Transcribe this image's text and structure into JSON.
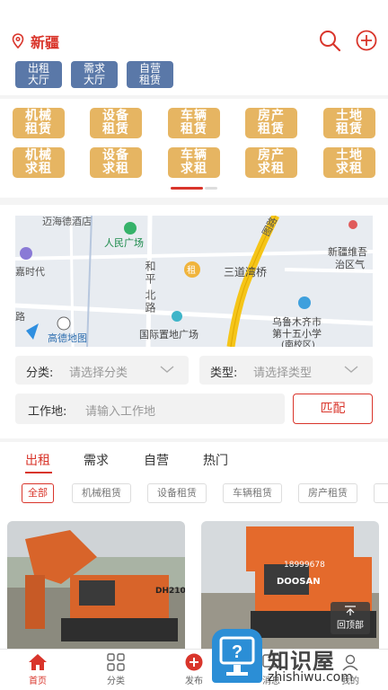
{
  "header": {
    "location": "新疆",
    "icons": [
      "location-pin-icon",
      "search-icon",
      "add-circle-icon"
    ]
  },
  "halls": [
    "出租\n大厅",
    "需求\n大厅",
    "自营\n租赁"
  ],
  "categories": {
    "row1": [
      "机械\n租赁",
      "设备\n租赁",
      "车辆\n租赁",
      "房产\n租赁",
      "土地\n租赁"
    ],
    "row2": [
      "机械\n求租",
      "设备\n求租",
      "车辆\n求租",
      "房产\n求租",
      "土地\n求租"
    ]
  },
  "map": {
    "labels": {
      "hotel": "迈海德酒店",
      "people_square": "人民广场",
      "hepingbei_1": "和平",
      "hepingbei_2": "北路",
      "rent": "租",
      "sandao": "三道湾桥",
      "xinjiang_1": "新疆维吾",
      "xinjiang_2": "治区气",
      "jiashidai": "嘉时代",
      "gaode": "高德地图",
      "guoji": "国际置地广场",
      "school_1": "乌鲁木齐市",
      "school_2": "第十五小学",
      "school_3": "(南校区)",
      "road_a": "路",
      "road_b": "图路"
    }
  },
  "filters": {
    "category_label": "分类:",
    "category_placeholder": "请选择分类",
    "type_label": "类型:",
    "type_placeholder": "请选择类型",
    "work_label": "工作地:",
    "work_placeholder": "请输入工作地",
    "match_button": "匹配"
  },
  "tabs": [
    "出租",
    "需求",
    "自营",
    "热门"
  ],
  "sub_filters": [
    "全部",
    "机械租赁",
    "设备租赁",
    "车辆租赁",
    "房产租赁"
  ],
  "cards": [
    {
      "brand": "DH210"
    },
    {
      "brand": "DOOSAN",
      "plate": "18999678"
    }
  ],
  "back_to_top": "回顶部",
  "nav": [
    "首页",
    "分类",
    "发布",
    "消息",
    "我的"
  ],
  "watermark": {
    "main": "知识屋",
    "url": "zhishiwu.com"
  },
  "colors": {
    "accent": "#d9352b",
    "hall": "#5a78a8",
    "category": "#e6b562"
  }
}
